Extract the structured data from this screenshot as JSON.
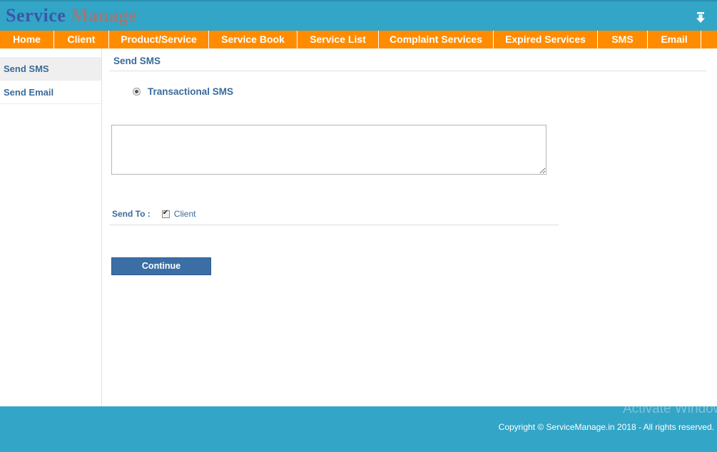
{
  "header": {
    "logo_part1": "Service",
    "logo_part2": "Manage"
  },
  "nav": {
    "items": [
      {
        "label": "Home"
      },
      {
        "label": "Client"
      },
      {
        "label": "Product/Service"
      },
      {
        "label": "Service Book"
      },
      {
        "label": "Service List"
      },
      {
        "label": "Complaint Services"
      },
      {
        "label": "Expired Services"
      },
      {
        "label": "SMS"
      },
      {
        "label": "Email"
      }
    ]
  },
  "sidebar": {
    "items": [
      {
        "label": "Send SMS"
      },
      {
        "label": "Send Email"
      }
    ]
  },
  "main": {
    "title": "Send SMS",
    "radio_label": "Transactional SMS",
    "message_value": "",
    "send_to_label": "Send To :",
    "send_to_option": "Client",
    "continue_label": "Continue"
  },
  "footer": {
    "watermark": "Activate Windows",
    "copyright": "Copyright © ServiceManage.in 2018 - All rights reserved."
  },
  "colors": {
    "header_bg": "#33a5c7",
    "nav_bg": "#ff8c00",
    "accent_text": "#3a6a9a",
    "button_bg": "#3b6ea5"
  }
}
